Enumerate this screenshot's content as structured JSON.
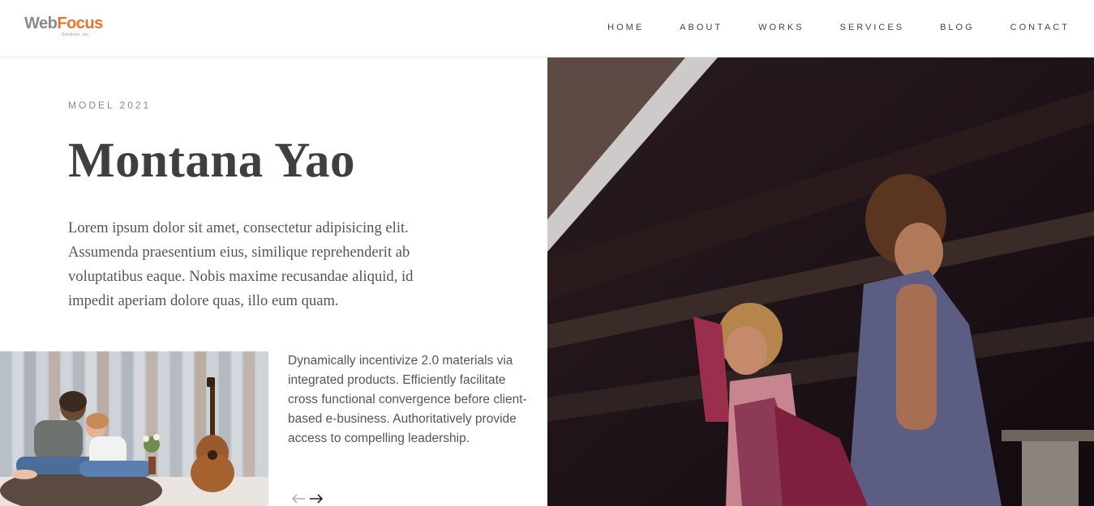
{
  "brand": {
    "name_part1": "Web",
    "name_part2": "Focus",
    "tagline": "Solutions, Inc."
  },
  "nav": {
    "items": [
      {
        "label": "HOME"
      },
      {
        "label": "ABOUT"
      },
      {
        "label": "WORKS"
      },
      {
        "label": "SERVICES"
      },
      {
        "label": "BLOG"
      },
      {
        "label": "CONTACT"
      }
    ]
  },
  "feature": {
    "eyebrow": "MODEL 2021",
    "title": "Montana Yao",
    "lede": "Lorem ipsum dolor sit amet, consectetur adipisicing elit. Assumenda praesentium eius, similique reprehenderit ab voluptatibus eaque. Nobis maxime recusandae aliquid, id impedit aperiam dolore quas, illo eum quam.",
    "description": "Dynamically incentivize 2.0 materials via integrated products. Efficiently facilitate cross functional convergence before client-based e-business. Authoritatively provide access to compelling leadership."
  },
  "slider": {
    "prev_icon": "arrow-left-icon",
    "next_icon": "arrow-right-icon"
  },
  "colors": {
    "brand_gray": "#8a8a8a",
    "brand_orange": "#e8742a",
    "text_dark": "#3f3f3f",
    "text_body": "#555555"
  }
}
